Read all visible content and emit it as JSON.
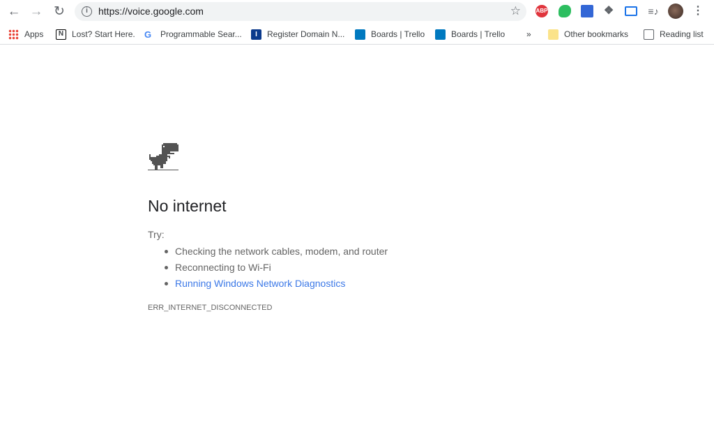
{
  "toolbar": {
    "url": "https://voice.google.com",
    "icons": [
      "back-icon",
      "forward-icon",
      "reload-icon",
      "info-icon",
      "star-icon"
    ]
  },
  "extensions": [
    {
      "name": "adblock-plus-icon",
      "label": "ABP",
      "color": "#e0353d"
    },
    {
      "name": "evernote-icon",
      "color": "#2dbe60"
    },
    {
      "name": "extension-blue-icon",
      "color": "#3367d6"
    },
    {
      "name": "puzzle-icon",
      "color": "#5f6368"
    },
    {
      "name": "cast-icon",
      "color": "#1a73e8"
    },
    {
      "name": "media-icon",
      "color": "#5f6368"
    }
  ],
  "bookmarks": [
    {
      "label": "Apps",
      "icon": "apps-grid-icon"
    },
    {
      "label": "Lost? Start Here.",
      "icon": "notion-icon"
    },
    {
      "label": "Programmable Sear...",
      "icon": "google-icon"
    },
    {
      "label": "Register Domain N...",
      "icon": "register-icon"
    },
    {
      "label": "Boards | Trello",
      "icon": "trello-icon"
    },
    {
      "label": "Boards | Trello",
      "icon": "trello-icon"
    }
  ],
  "bookmarks_more": "»",
  "other_bookmarks": "Other bookmarks",
  "reading_list": "Reading list",
  "error": {
    "title": "No internet",
    "try": "Try:",
    "suggestions": [
      "Checking the network cables, modem, and router",
      "Reconnecting to Wi-Fi",
      "Running Windows Network Diagnostics"
    ],
    "code": "ERR_INTERNET_DISCONNECTED"
  },
  "colors": {
    "link": "#3b78e7",
    "text": "#646464",
    "omnibox": "#f1f3f4"
  }
}
